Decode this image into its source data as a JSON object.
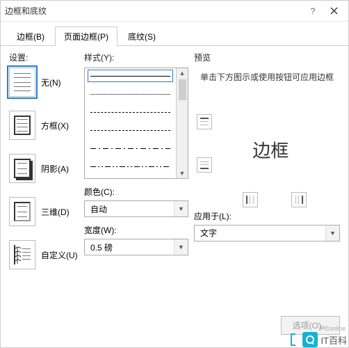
{
  "title": "边框和底纹",
  "tabs": [
    {
      "label": "边框(B)"
    },
    {
      "label": "页面边框(P)"
    },
    {
      "label": "底纹(S)"
    }
  ],
  "settings": {
    "label": "设置:",
    "options": {
      "none": "无(N)",
      "box": "方框(X)",
      "shadow": "阴影(A)",
      "threeD": "三维(D)",
      "custom": "自定义(U)"
    }
  },
  "style": {
    "label": "样式(Y):",
    "color_label": "颜色(C):",
    "color_value": "自动",
    "width_label": "宽度(W):",
    "width_value": "0.5 磅"
  },
  "preview": {
    "label": "预览",
    "hint": "单击下方图示或使用按钮可应用边框",
    "sample": "边框",
    "apply_label": "应用于(L):",
    "apply_value": "文字"
  },
  "options_button": "选项(O)...",
  "watermark": {
    "sub": "PConline",
    "main": "IT百科"
  }
}
